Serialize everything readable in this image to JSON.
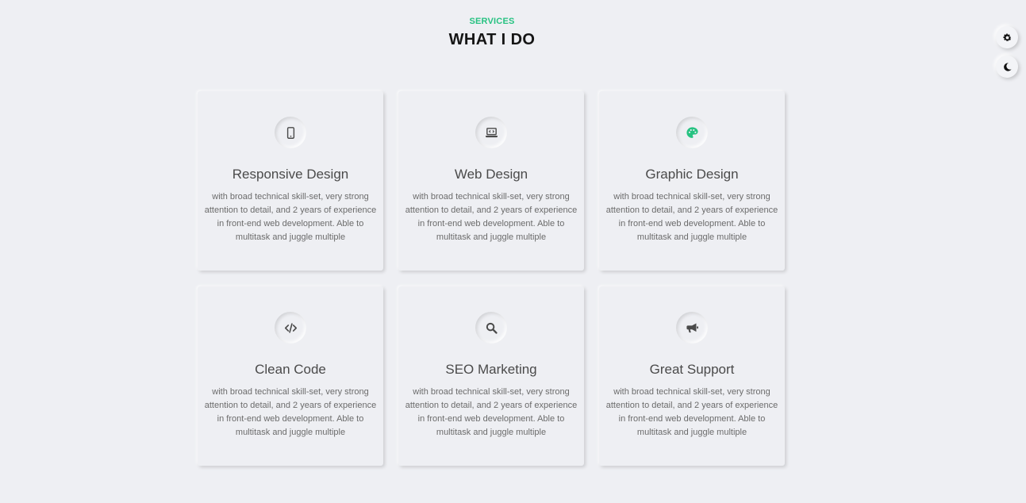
{
  "header": {
    "eyebrow": "SERVICES",
    "title": "WHAT I DO"
  },
  "controls": {
    "settings_icon": "gear-icon",
    "theme_icon": "moon-icon"
  },
  "colors": {
    "accent": "#26c281",
    "icon": "#4a4a4a",
    "background": "#eeeff3"
  },
  "services": [
    {
      "icon": "mobile-icon",
      "title": "Responsive Design",
      "text": "with broad technical skill-set, very strong attention to detail, and 2 years of experience in front-end web development. Able to multitask and juggle multiple"
    },
    {
      "icon": "laptop-code-icon",
      "title": "Web Design",
      "text": "with broad technical skill-set, very strong attention to detail, and 2 years of experience in front-end web development. Able to multitask and juggle multiple"
    },
    {
      "icon": "palette-icon",
      "title": "Graphic Design",
      "text": "with broad technical skill-set, very strong attention to detail, and 2 years of experience in front-end web development. Able to multitask and juggle multiple"
    },
    {
      "icon": "code-icon",
      "title": "Clean Code",
      "text": "with broad technical skill-set, very strong attention to detail, and 2 years of experience in front-end web development. Able to multitask and juggle multiple"
    },
    {
      "icon": "search-icon",
      "title": "SEO Marketing",
      "text": "with broad technical skill-set, very strong attention to detail, and 2 years of experience in front-end web development. Able to multitask and juggle multiple"
    },
    {
      "icon": "megaphone-icon",
      "title": "Great Support",
      "text": "with broad technical skill-set, very strong attention to detail, and 2 years of experience in front-end web development. Able to multitask and juggle multiple"
    }
  ]
}
